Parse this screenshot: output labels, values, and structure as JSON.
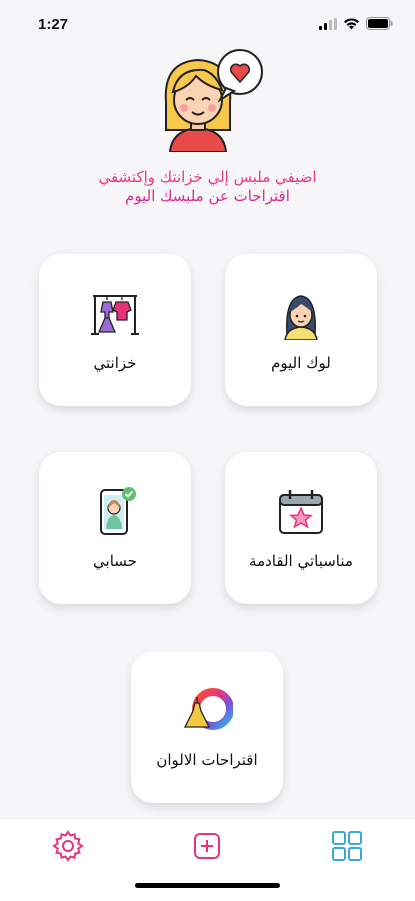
{
  "status": {
    "time": "1:27"
  },
  "header": {
    "subtitle_line1": "اضيفي ملبس إلي خزانتك وإكتشفي",
    "subtitle_line2": "اقتراحات عن ملبسك اليوم"
  },
  "menu": {
    "today_look": "لوك اليوم",
    "wardrobe": "خزانتي",
    "upcoming_events": "مناسباتي القادمة",
    "account": "حسابي",
    "color_suggestions": "اقتراحات الالوان"
  },
  "colors": {
    "accent_pink": "#e9337f",
    "accent_blue": "#38a9d6"
  },
  "tabbar": {
    "icons": [
      "gear-icon",
      "add-icon",
      "grid-icon"
    ]
  }
}
